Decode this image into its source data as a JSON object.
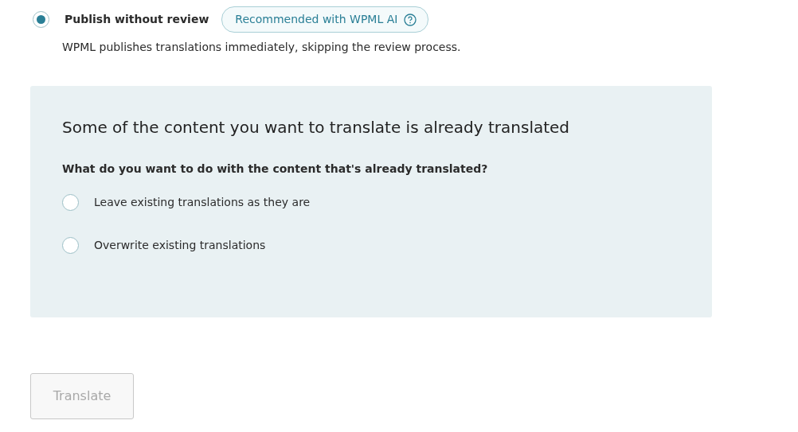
{
  "publish_option": {
    "label": "Publish without review",
    "selected": true,
    "badge": "Recommended with WPML AI",
    "description": "WPML publishes translations immediately, skipping the review process."
  },
  "existing_panel": {
    "title": "Some of the content you want to translate is already translated",
    "question": "What do you want to do with the content that's already translated?",
    "options": [
      {
        "label": "Leave existing translations as they are",
        "selected": false
      },
      {
        "label": "Overwrite existing translations",
        "selected": false
      }
    ]
  },
  "translate_button": {
    "label": "Translate",
    "disabled": true
  }
}
